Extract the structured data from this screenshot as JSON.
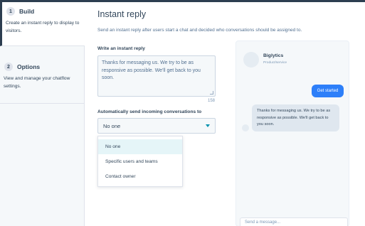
{
  "steps": [
    {
      "number": "1",
      "title": "Build",
      "description": "Create an instant reply to display to visitors."
    },
    {
      "number": "2",
      "title": "Options",
      "description": "View and manage your chatflow settings."
    }
  ],
  "main": {
    "title": "Instant reply",
    "description": "Send an instant reply after users start a chat and decided who conversations should be assigned to.",
    "reply_label": "Write an instant reply",
    "reply_text": "Thanks for messaging us. We try to be as responsive as possible. We'll get back to you soon.",
    "char_count": "158",
    "assign_label": "Automatically send incoming conversations to",
    "assign_value": "No one",
    "assign_options": [
      "No one",
      "Specific users and teams",
      "Contact owner"
    ]
  },
  "preview": {
    "company_name": "Biglytics",
    "company_subtitle": "Product/service",
    "user_message": "Get started",
    "bot_message": "Thanks for messaging us. We try to be as responsive as possible. We'll get back to you soon.",
    "input_placeholder": "Send a message..."
  },
  "colors": {
    "accent": "#2d7ff9",
    "highlight": "#e5f5f8",
    "caret": "#0091ae"
  }
}
